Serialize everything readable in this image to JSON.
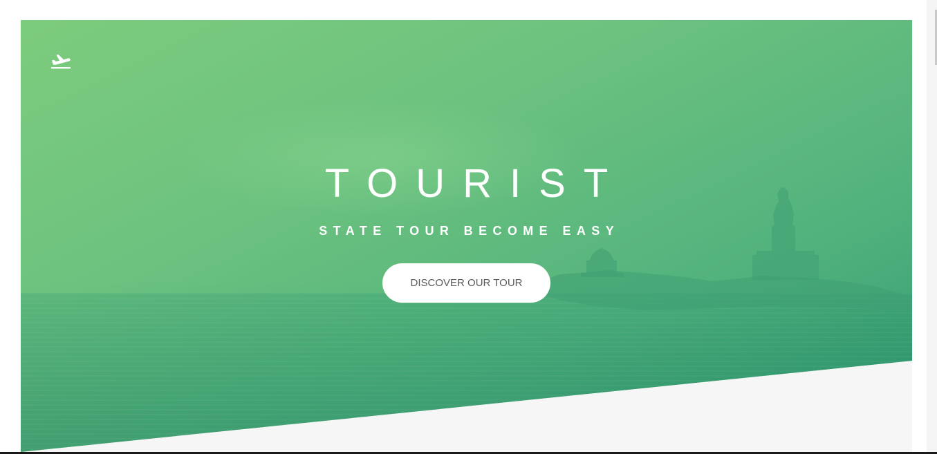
{
  "hero": {
    "logo_icon": "plane-departure-icon",
    "title": "TOURIST",
    "subtitle": "STATE TOUR BECOME EASY",
    "cta_label": "DISCOVER OUR TOUR"
  },
  "colors": {
    "hero_green_light": "#7dcc7d",
    "hero_green_dark": "#2f9a70",
    "page_background": "#f6f6f6",
    "button_background": "#ffffff",
    "button_text": "#5b5b5b"
  }
}
